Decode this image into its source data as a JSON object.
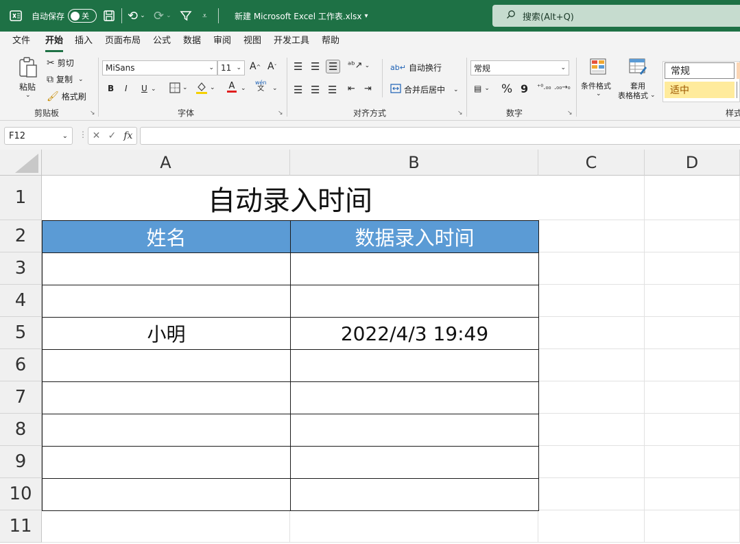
{
  "titlebar": {
    "app_icon": "excel-icon",
    "autosave_label": "自动保存",
    "toggle_state": "关",
    "filename": "新建 Microsoft Excel 工作表.xlsx",
    "filename_caret": "⌄",
    "search_placeholder": "搜索(Alt+Q)",
    "bg_color": "#1e7145"
  },
  "menu": {
    "tabs": [
      "文件",
      "开始",
      "插入",
      "页面布局",
      "公式",
      "数据",
      "审阅",
      "视图",
      "开发工具",
      "帮助"
    ],
    "active": "开始"
  },
  "ribbon": {
    "clipboard": {
      "paste": "粘贴",
      "cut": "剪切",
      "copy": "复制",
      "format_painter": "格式刷",
      "label": "剪贴板"
    },
    "font": {
      "name": "MiSans",
      "size": "11",
      "bold": "B",
      "italic": "I",
      "underline": "U",
      "font_color": "A",
      "label": "字体"
    },
    "alignment": {
      "wrap": "自动换行",
      "merge": "合并后居中",
      "label": "对齐方式"
    },
    "number": {
      "format": "常规",
      "percent": "%",
      "comma": "9",
      "label": "数字"
    },
    "styles": {
      "conditional": "条件格式",
      "table_line1": "套用",
      "table_line2": "表格格式",
      "normal": "常规",
      "neutral": "适中",
      "label": "样式"
    }
  },
  "formula_bar": {
    "name_box": "F12",
    "fx": "fx",
    "value": ""
  },
  "sheet": {
    "columns": [
      "A",
      "B",
      "C",
      "D"
    ],
    "rows": [
      "1",
      "2",
      "3",
      "4",
      "5",
      "6",
      "7",
      "8",
      "9",
      "10",
      "11"
    ],
    "title": "自动录入时间",
    "headers": [
      "姓名",
      "数据录入时间"
    ],
    "header_color": "#5b9bd5",
    "data": [
      [
        "",
        ""
      ],
      [
        "",
        ""
      ],
      [
        "小明",
        "2022/4/3 19:49"
      ],
      [
        "",
        ""
      ],
      [
        "",
        ""
      ],
      [
        "",
        ""
      ],
      [
        "",
        ""
      ],
      [
        "",
        ""
      ]
    ]
  }
}
